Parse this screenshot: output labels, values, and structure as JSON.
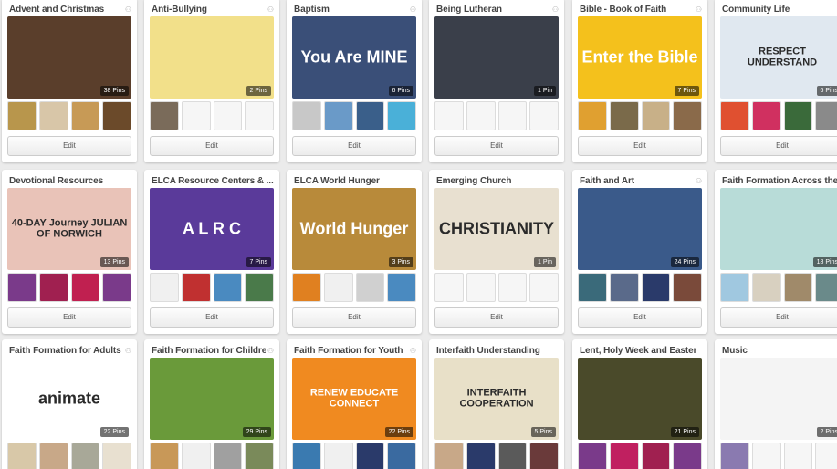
{
  "boards": [
    {
      "title": "Advent and Christmas",
      "pins": "38 Pins",
      "edit": "Edit",
      "collab_icon": "group-icon",
      "cover_text": "",
      "cover_color": "#5a3e2b",
      "thumb_colors": [
        "#b8964c",
        "#d8c6a8",
        "#c79a56",
        "#6b4a2a"
      ]
    },
    {
      "title": "Anti-Bullying",
      "pins": "2 Pins",
      "edit": "Edit",
      "collab_icon": "group-icon",
      "cover_text": "",
      "cover_color": "#f2e08a",
      "thumb_colors": [
        "#7a6b5a",
        "#f6f6f6",
        "#f6f6f6",
        "#f6f6f6"
      ]
    },
    {
      "title": "Baptism",
      "pins": "6 Pins",
      "edit": "Edit",
      "collab_icon": "group-icon",
      "cover_text": "You Are MINE",
      "cover_color": "#3a4f78",
      "thumb_colors": [
        "#c8c8c8",
        "#6a9ac8",
        "#3a5f8a",
        "#4ab0d8"
      ]
    },
    {
      "title": "Being Lutheran",
      "pins": "1 Pin",
      "edit": "Edit",
      "collab_icon": "group-icon",
      "cover_text": "",
      "cover_color": "#3a3f4a",
      "thumb_colors": [
        "#f6f6f6",
        "#f6f6f6",
        "#f6f6f6",
        "#f6f6f6"
      ]
    },
    {
      "title": "Bible - Book of Faith",
      "pins": "7 Pins",
      "edit": "Edit",
      "collab_icon": "group-icon",
      "cover_text": "Enter the Bible",
      "cover_color": "#f4c11c",
      "thumb_colors": [
        "#e0a030",
        "#7a6a4a",
        "#c8b088",
        "#8a6a4a"
      ]
    },
    {
      "title": "Community Life",
      "pins": "6 Pins",
      "edit": "Edit",
      "collab_icon": "group-icon",
      "cover_text": "RESPECT UNDERSTAND",
      "cover_color": "#e0e8f0",
      "thumb_colors": [
        "#e05030",
        "#d03060",
        "#3a6a3a",
        "#8a8a8a"
      ]
    },
    {
      "title": "Devotional Resources",
      "pins": "13 Pins",
      "edit": "Edit",
      "collab_icon": "",
      "cover_text": "40-DAY Journey JULIAN OF NORWICH",
      "cover_color": "#e9c3b8",
      "thumb_colors": [
        "#7a3a8a",
        "#a02050",
        "#c02050",
        "#7a3a8a"
      ]
    },
    {
      "title": "ELCA Resource Centers & ...",
      "pins": "7 Pins",
      "edit": "Edit",
      "collab_icon": "",
      "cover_text": "A L R C",
      "cover_color": "#5a3a9a",
      "thumb_colors": [
        "#f0f0f0",
        "#c03030",
        "#4a8ac0",
        "#4a7a4a"
      ]
    },
    {
      "title": "ELCA World Hunger",
      "pins": "3 Pins",
      "edit": "Edit",
      "collab_icon": "",
      "cover_text": "World Hunger",
      "cover_color": "#b88a3a",
      "thumb_colors": [
        "#e08020",
        "#f0f0f0",
        "#d0d0d0",
        "#4a8ac0"
      ]
    },
    {
      "title": "Emerging Church",
      "pins": "1 Pin",
      "edit": "Edit",
      "collab_icon": "",
      "cover_text": "CHRISTIANITY",
      "cover_color": "#e8e0d0",
      "thumb_colors": [
        "#f6f6f6",
        "#f6f6f6",
        "#f6f6f6",
        "#f6f6f6"
      ]
    },
    {
      "title": "Faith and Art",
      "pins": "24 Pins",
      "edit": "Edit",
      "collab_icon": "group-icon",
      "cover_text": "",
      "cover_color": "#3a5a8a",
      "thumb_colors": [
        "#3a6a7a",
        "#5a6a8a",
        "#2a3a6a",
        "#7a4a3a"
      ]
    },
    {
      "title": "Faith Formation Across the ...",
      "pins": "18 Pins",
      "edit": "Edit",
      "collab_icon": "",
      "cover_text": "",
      "cover_color": "#b8dcd8",
      "thumb_colors": [
        "#a0c8e0",
        "#d8d0c0",
        "#a08a6a",
        "#6a8a8a"
      ]
    },
    {
      "title": "Faith Formation for Adults",
      "pins": "22 Pins",
      "edit": "Edit",
      "collab_icon": "group-icon",
      "cover_text": "animate",
      "cover_color": "#ffffff",
      "thumb_colors": [
        "#d8c8a8",
        "#c8a888",
        "#a8a898",
        "#e8e0d0"
      ]
    },
    {
      "title": "Faith Formation for Children",
      "pins": "29 Pins",
      "edit": "Edit",
      "collab_icon": "group-icon",
      "cover_text": "",
      "cover_color": "#6a9a3a",
      "thumb_colors": [
        "#c89858",
        "#f0f0f0",
        "#a0a0a0",
        "#7a8a5a"
      ]
    },
    {
      "title": "Faith Formation for Youth",
      "pins": "22 Pins",
      "edit": "Edit",
      "collab_icon": "group-icon",
      "cover_text": "RENEW EDUCATE CONNECT",
      "cover_color": "#f08a20",
      "thumb_colors": [
        "#3a7ab0",
        "#f0f0f0",
        "#2a3a6a",
        "#3a6aa0"
      ]
    },
    {
      "title": "Interfaith Understanding",
      "pins": "5 Pins",
      "edit": "Edit",
      "collab_icon": "",
      "cover_text": "INTERFAITH COOPERATION",
      "cover_color": "#e8e0c8",
      "thumb_colors": [
        "#c8a888",
        "#2a3a6a",
        "#5a5a5a",
        "#6a3a3a"
      ]
    },
    {
      "title": "Lent, Holy Week and Easter",
      "pins": "21 Pins",
      "edit": "Edit",
      "collab_icon": "",
      "cover_text": "",
      "cover_color": "#4a4a2a",
      "thumb_colors": [
        "#7a3a8a",
        "#c02060",
        "#a02050",
        "#7a3a8a"
      ]
    },
    {
      "title": "Music",
      "pins": "2 Pins",
      "edit": "Edit",
      "collab_icon": "",
      "cover_text": "",
      "cover_color": "#f4f4f4",
      "thumb_colors": [
        "#8a7ab0",
        "#f6f6f6",
        "#f6f6f6",
        "#f6f6f6"
      ]
    }
  ]
}
